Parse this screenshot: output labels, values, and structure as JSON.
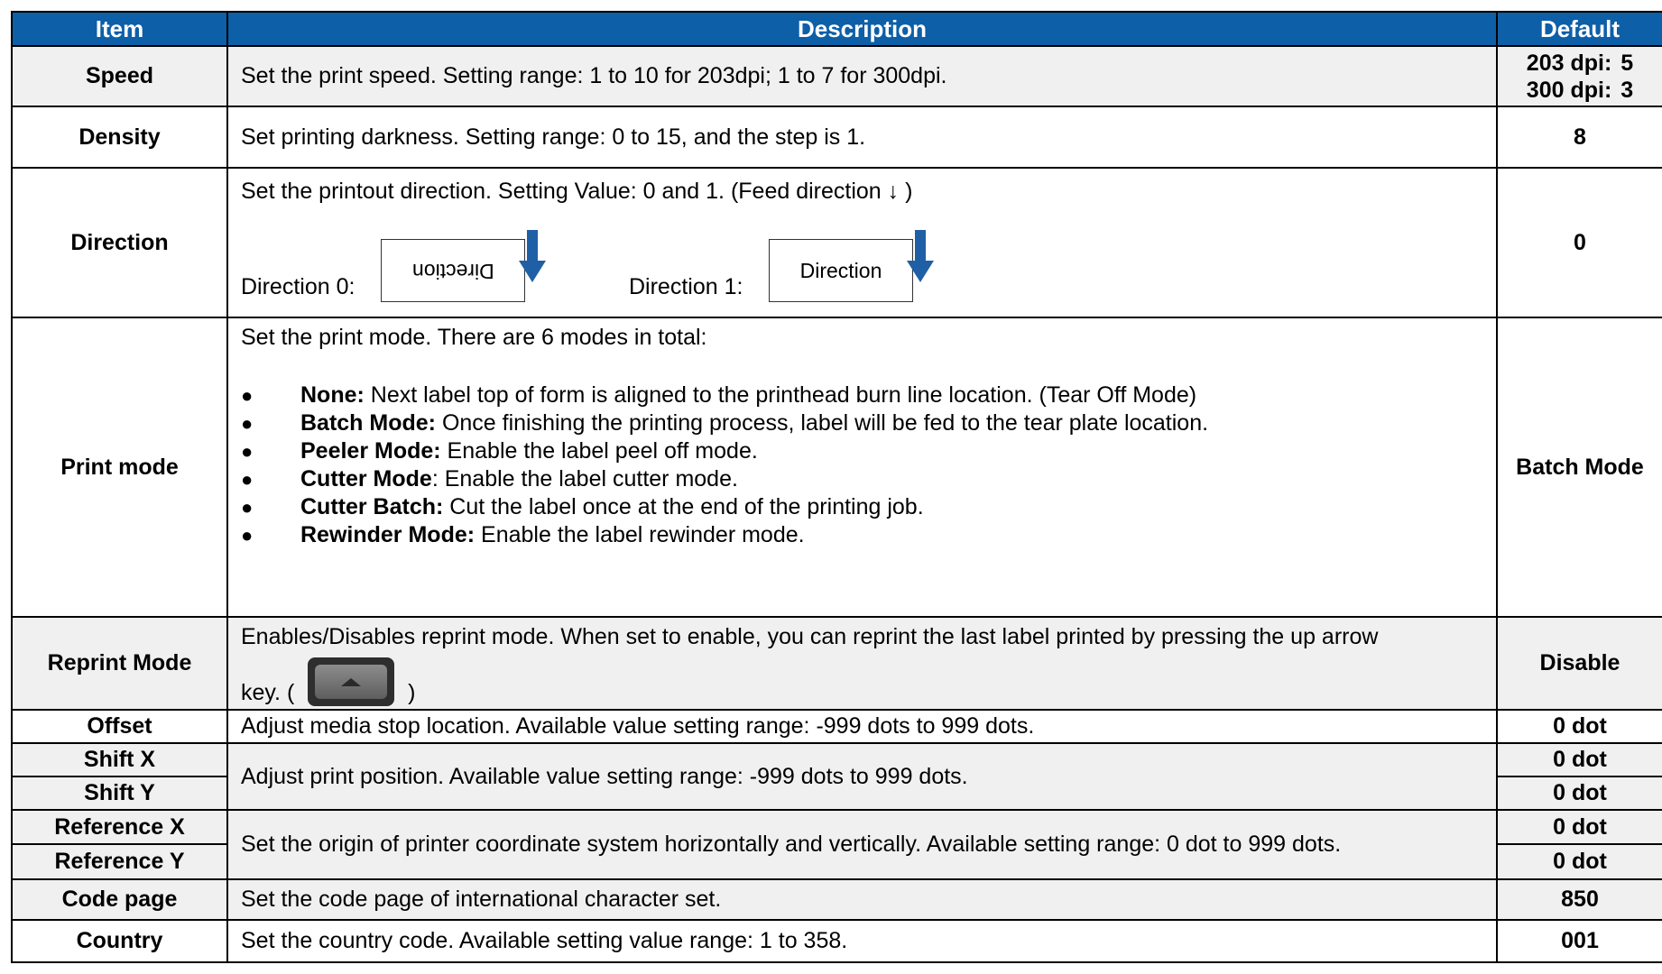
{
  "header": {
    "item": "Item",
    "description": "Description",
    "default": "Default"
  },
  "rows": {
    "speed": {
      "item": "Speed",
      "desc": "Set the print speed. Setting range: 1 to 10 for 203dpi; 1 to 7 for 300dpi.",
      "def_203_label": "203 dpi:",
      "def_203_value": "5",
      "def_300_label": "300 dpi:",
      "def_300_value": "3"
    },
    "density": {
      "item": "Density",
      "desc": "Set printing darkness. Setting range: 0 to 15, and the step is 1.",
      "def": "8"
    },
    "direction": {
      "item": "Direction",
      "desc": "Set the printout direction. Setting Value: 0 and 1.    (Feed direction ↓ )",
      "label0": "Direction 0:",
      "label1": "Direction 1:",
      "box_text": "Direction",
      "def": "0"
    },
    "print_mode": {
      "item": "Print mode",
      "intro": "Set the print mode. There are 6 modes in total:",
      "modes": [
        {
          "name": "None:",
          "text": " Next label top of form is aligned to the printhead burn line location. (Tear Off Mode)"
        },
        {
          "name": "Batch Mode:",
          "text": " Once finishing the printing process, label will be fed to the tear plate location."
        },
        {
          "name": "Peeler Mode:",
          "text": " Enable the label peel off mode."
        },
        {
          "name": "Cutter Mode",
          "text": ": Enable the label cutter mode."
        },
        {
          "name": "Cutter Batch:",
          "text": " Cut the label once at the end of the printing job."
        },
        {
          "name": "Rewinder Mode:",
          "text": " Enable the label rewinder mode."
        }
      ],
      "def": "Batch Mode"
    },
    "reprint": {
      "item": "Reprint Mode",
      "desc": "Enables/Disables reprint mode. When set to enable, you can reprint the last label printed by pressing the up arrow",
      "key_prefix": "key. (",
      "key_suffix": ")",
      "key_icon": "up-arrow-key-icon",
      "def": "Disable"
    },
    "offset": {
      "item": "Offset",
      "desc": "Adjust media stop location. Available value setting range: -999 dots to 999 dots.",
      "def": "0 dot"
    },
    "shift": {
      "item_x": "Shift X",
      "item_y": "Shift Y",
      "desc": "Adjust print position. Available value setting range: -999 dots to 999 dots.",
      "def_x": "0 dot",
      "def_y": "0 dot"
    },
    "reference": {
      "item_x": "Reference X",
      "item_y": "Reference Y",
      "desc": "Set the origin of printer coordinate system horizontally and vertically. Available setting range: 0 dot to 999 dots.",
      "def_x": "0 dot",
      "def_y": "0 dot"
    },
    "code_page": {
      "item": "Code page",
      "desc": "Set the code page of international character set.",
      "def": "850"
    },
    "country": {
      "item": "Country",
      "desc": "Set the country code. Available setting value range: 1 to 358.",
      "def": "001"
    }
  },
  "colors": {
    "header_bg": "#0d5fa8",
    "header_text": "#ffffff",
    "shade_row": "#f0f0f0",
    "arrow": "#1f5fa6"
  }
}
